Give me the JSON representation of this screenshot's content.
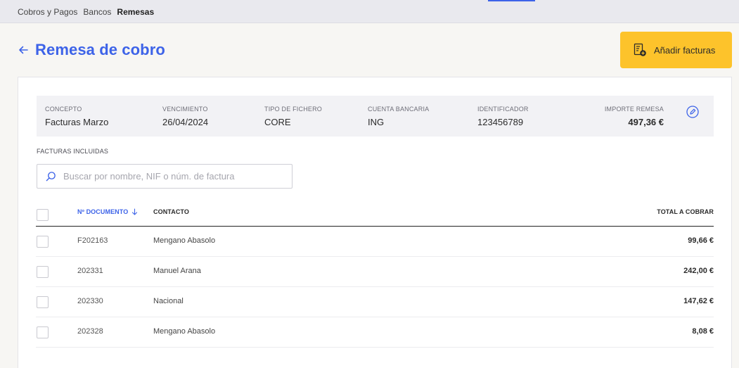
{
  "breadcrumbs": [
    "Cobros y Pagos",
    "Bancos",
    "Remesas"
  ],
  "title": "Remesa de cobro",
  "add_button_label": "Añadir facturas",
  "summary": {
    "concepto": {
      "label": "CONCEPTO",
      "value": "Facturas Marzo"
    },
    "vencimiento": {
      "label": "VENCIMIENTO",
      "value": "26/04/2024"
    },
    "tipo_fichero": {
      "label": "TIPO DE FICHERO",
      "value": "CORE"
    },
    "cuenta": {
      "label": "CUENTA BANCARIA",
      "value": "ING"
    },
    "identificador": {
      "label": "IDENTIFICADOR",
      "value": "123456789"
    },
    "importe": {
      "label": "IMPORTE REMESA",
      "value": "497,36 €"
    }
  },
  "section_label": "FACTURAS INCLUIDAS",
  "search": {
    "placeholder": "Buscar por nombre, NIF o núm. de factura"
  },
  "table": {
    "headers": {
      "documento": "Nº DOCUMENTO",
      "contacto": "CONTACTO",
      "total": "TOTAL A COBRAR"
    },
    "rows": [
      {
        "documento": "F202163",
        "contacto": "Mengano Abasolo",
        "total": "99,66 €"
      },
      {
        "documento": "202331",
        "contacto": "Manuel Arana",
        "total": "242,00 €"
      },
      {
        "documento": "202330",
        "contacto": "Nacional",
        "total": "147,62 €"
      },
      {
        "documento": "202328",
        "contacto": "Mengano Abasolo",
        "total": "8,08 €"
      }
    ]
  },
  "colors": {
    "accent": "#3d63e8",
    "button": "#fdc32b"
  },
  "icons": [
    "back-arrow-icon",
    "invoice-add-icon",
    "edit-pencil-icon",
    "search-icon",
    "sort-down-icon"
  ]
}
